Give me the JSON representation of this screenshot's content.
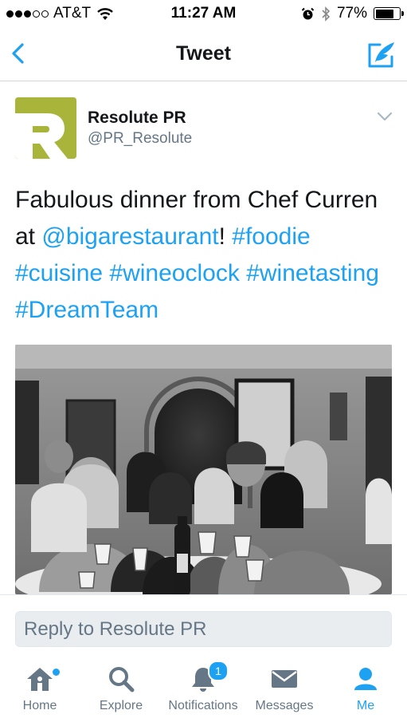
{
  "status_bar": {
    "carrier": "AT&T",
    "time": "11:27 AM",
    "battery": "77%",
    "battery_level": 0.77,
    "icons": [
      "signal-dots-icon",
      "wifi-icon",
      "alarm-icon",
      "bluetooth-icon",
      "battery-icon"
    ]
  },
  "nav": {
    "title": "Tweet",
    "back_icon": "chevron-left-icon",
    "compose_icon": "compose-tweet-icon"
  },
  "tweet": {
    "author_name": "Resolute PR",
    "author_handle": "@PR_Resolute",
    "avatar_letter": "R",
    "text_plain_1": "Fabulous dinner from Chef Curren at ",
    "mention": "@bigarestaurant",
    "text_plain_2": "! ",
    "hashtags": [
      "#foodie",
      "#cuisine",
      "#wineoclock",
      "#winetasting",
      "#DreamTeam"
    ],
    "menu_icon": "chevron-down-icon",
    "photo_icon": "group-photo"
  },
  "reply": {
    "placeholder": "Reply to Resolute PR"
  },
  "tabs": [
    {
      "label": "Home",
      "icon": "home-icon",
      "has_dot": true
    },
    {
      "label": "Explore",
      "icon": "search-icon"
    },
    {
      "label": "Notifications",
      "icon": "bell-icon",
      "badge": "1"
    },
    {
      "label": "Messages",
      "icon": "envelope-icon"
    },
    {
      "label": "Me",
      "icon": "person-icon",
      "active": true
    }
  ],
  "colors": {
    "accent": "#1da1f2",
    "avatar_bg": "#a9b53a",
    "secondary_text": "#657786"
  }
}
